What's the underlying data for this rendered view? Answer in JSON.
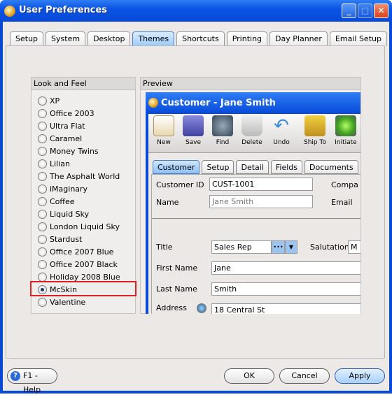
{
  "window": {
    "title": "User Preferences",
    "minimize": "_",
    "maximize": "□",
    "close": "✕"
  },
  "tabs": [
    "Setup",
    "System",
    "Desktop",
    "Themes",
    "Shortcuts",
    "Printing",
    "Day Planner",
    "Email Setup"
  ],
  "active_tab": "Themes",
  "look_and_feel": {
    "title": "Look and Feel",
    "selected": "McSkin",
    "options": [
      "XP",
      "Office 2003",
      "Ultra Flat",
      "Caramel",
      "Money Twins",
      "Lilian",
      "The Asphalt World",
      "iMaginary",
      "Coffee",
      "Liquid Sky",
      "London Liquid Sky",
      "Stardust",
      "Office 2007 Blue",
      "Office 2007 Black",
      "Holiday 2008 Blue",
      "McSkin",
      "Valentine"
    ]
  },
  "preview": {
    "title": "Preview",
    "window_title": "Customer - Jane Smith",
    "toolbar": [
      "New",
      "Save",
      "Find",
      "Delete",
      "Undo",
      "Ship To",
      "Initiate"
    ],
    "tabs": [
      "Customer",
      "Setup",
      "Detail",
      "Fields",
      "Documents"
    ],
    "form": {
      "customer_id_label": "Customer ID",
      "customer_id": "CUST-1001",
      "company_label": "Compa",
      "name_label": "Name",
      "name": "Jane Smith",
      "email_label": "Email",
      "title_label": "Title",
      "title": "Sales Rep",
      "title_more": "•••",
      "title_dropdown": "▼",
      "salutation_label": "Salutation",
      "salutation": "M",
      "first_name_label": "First Name",
      "first_name": "Jane",
      "last_name_label": "Last Name",
      "last_name": "Smith",
      "address_label": "Address",
      "address": "18 Central St"
    }
  },
  "buttons": {
    "help": "F1 - Help",
    "ok": "OK",
    "cancel": "Cancel",
    "apply": "Apply"
  }
}
